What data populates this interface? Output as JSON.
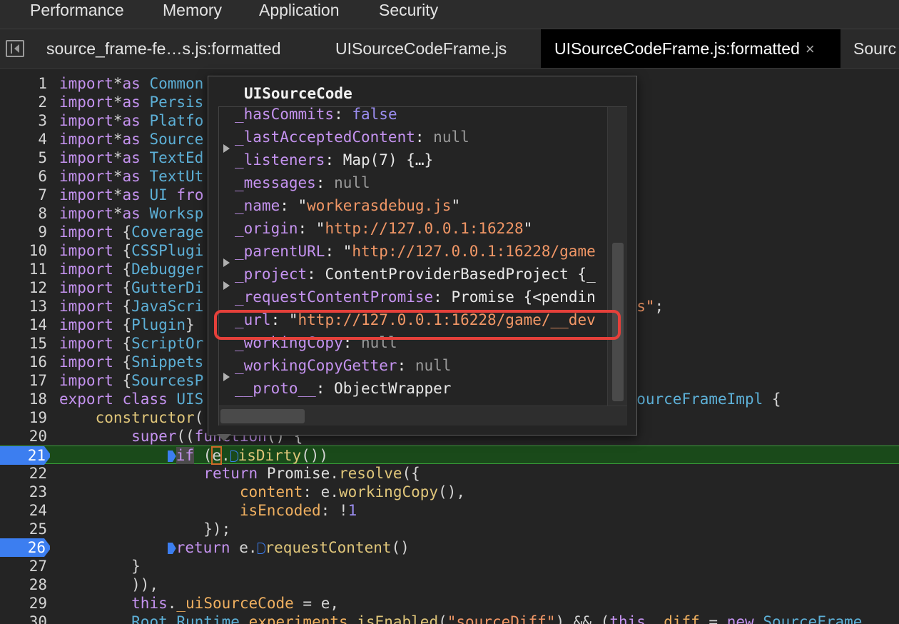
{
  "top_tabs": [
    "Performance",
    "Memory",
    "Application",
    "Security"
  ],
  "file_tabs": [
    {
      "label": "source_frame-fe…s.js:formatted"
    },
    {
      "label": "UISourceCodeFrame.js"
    },
    {
      "label": "UISourceCodeFrame.js:formatted",
      "close": "×"
    },
    {
      "label": "Sourc"
    }
  ],
  "code": {
    "line_numbers": [
      "1",
      "2",
      "3",
      "4",
      "5",
      "6",
      "7",
      "8",
      "9",
      "10",
      "11",
      "12",
      "13",
      "14",
      "15",
      "16",
      "17",
      "18",
      "19",
      "20",
      "21",
      "22",
      "23",
      "24",
      "25",
      "26",
      "27",
      "28",
      "29",
      "30"
    ],
    "breakpoint_lines": [
      "21",
      "26"
    ],
    "execution_line": "21"
  },
  "popover": {
    "title": "UISourceCode",
    "properties": [
      {
        "key": "_hasCommits",
        "value": "false"
      },
      {
        "key": "_lastAcceptedContent",
        "value": "null"
      },
      {
        "key": "_listeners",
        "value": "Map(7) {…}"
      },
      {
        "key": "_messages",
        "value": "null"
      },
      {
        "key": "_name",
        "value": "workerasdebug.js"
      },
      {
        "key": "_origin",
        "value": "http://127.0.0.1:16228"
      },
      {
        "key": "_parentURL",
        "value": "http://127.0.0.1:16228/game"
      },
      {
        "key": "_project",
        "value": "ContentProviderBasedProject {_"
      },
      {
        "key": "_requestContentPromise",
        "value": "Promise {<pendin"
      },
      {
        "key": "_url",
        "value": "http://127.0.0.1:16228/game/__dev"
      },
      {
        "key": "_workingCopy",
        "value": "null"
      },
      {
        "key": "_workingCopyGetter",
        "value": "null"
      },
      {
        "key": "__proto__",
        "value": "ObjectWrapper"
      }
    ]
  },
  "colors": {
    "highlight_box": "#e5403a",
    "breakpoint": "#3c7ef0",
    "exec_line": "#3aa03a"
  }
}
